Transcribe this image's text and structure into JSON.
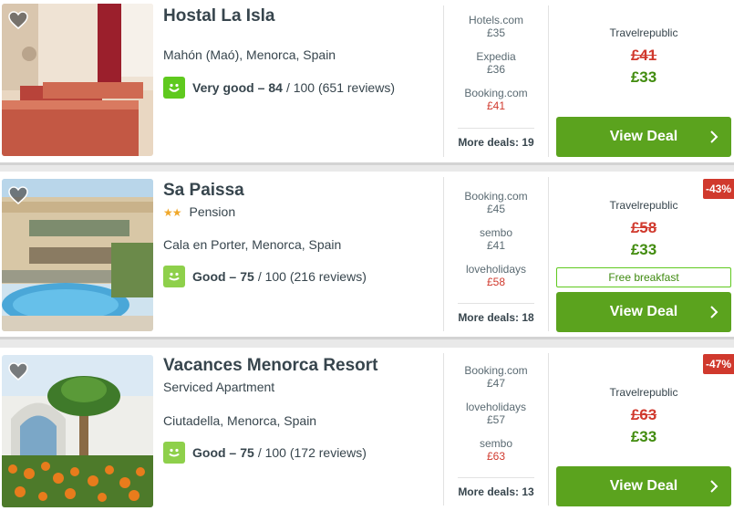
{
  "cards": [
    {
      "name": "Hostal La Isla",
      "subtitle": "",
      "location": "Mahón (Maó), Menorca, Spain",
      "rating": {
        "word": "Very good –",
        "score": "84",
        "suffix": "/ 100 (651 reviews)"
      },
      "deals": [
        {
          "site": "Hotels.com",
          "price": "£35"
        },
        {
          "site": "Expedia",
          "price": "£36"
        },
        {
          "site": "Booking.com",
          "price": "£41"
        }
      ],
      "more_deals": "More deals: 19",
      "provider": "Travelrepublic",
      "old_price": "£41",
      "new_price": "£33",
      "view_deal": "View Deal"
    },
    {
      "name": "Sa Paissa",
      "stars": "★★",
      "subtitle": "Pension",
      "location": "Cala en Porter, Menorca, Spain",
      "rating": {
        "word": "Good –",
        "score": "75",
        "suffix": "/ 100 (216 reviews)"
      },
      "deals": [
        {
          "site": "Booking.com",
          "price": "£45"
        },
        {
          "site": "sembo",
          "price": "£41"
        },
        {
          "site": "loveholidays",
          "price": "£58"
        }
      ],
      "more_deals": "More deals: 18",
      "discount": "-43%",
      "provider": "Travelrepublic",
      "old_price": "£58",
      "new_price": "£33",
      "free_breakfast": "Free breakfast",
      "view_deal": "View Deal"
    },
    {
      "name": "Vacances Menorca Resort",
      "subtitle": "Serviced Apartment",
      "location": "Ciutadella, Menorca, Spain",
      "rating": {
        "word": "Good –",
        "score": "75",
        "suffix": "/ 100 (172 reviews)"
      },
      "deals": [
        {
          "site": "Booking.com",
          "price": "£47"
        },
        {
          "site": "loveholidays",
          "price": "£57"
        },
        {
          "site": "sembo",
          "price": "£63"
        }
      ],
      "more_deals": "More deals: 13",
      "discount": "-47%",
      "provider": "Travelrepublic",
      "old_price": "£63",
      "new_price": "£33",
      "view_deal": "View Deal"
    }
  ],
  "icons": {
    "favorite": "heart-icon",
    "rating": "smiley-icon",
    "next": "chevron-right-icon"
  },
  "colors": {
    "accent_green": "#5ba31e",
    "rating_green": "#5fc91e",
    "price_green": "#428c0f",
    "strike_red": "#d0392d",
    "star_gold": "#f0a82b"
  }
}
